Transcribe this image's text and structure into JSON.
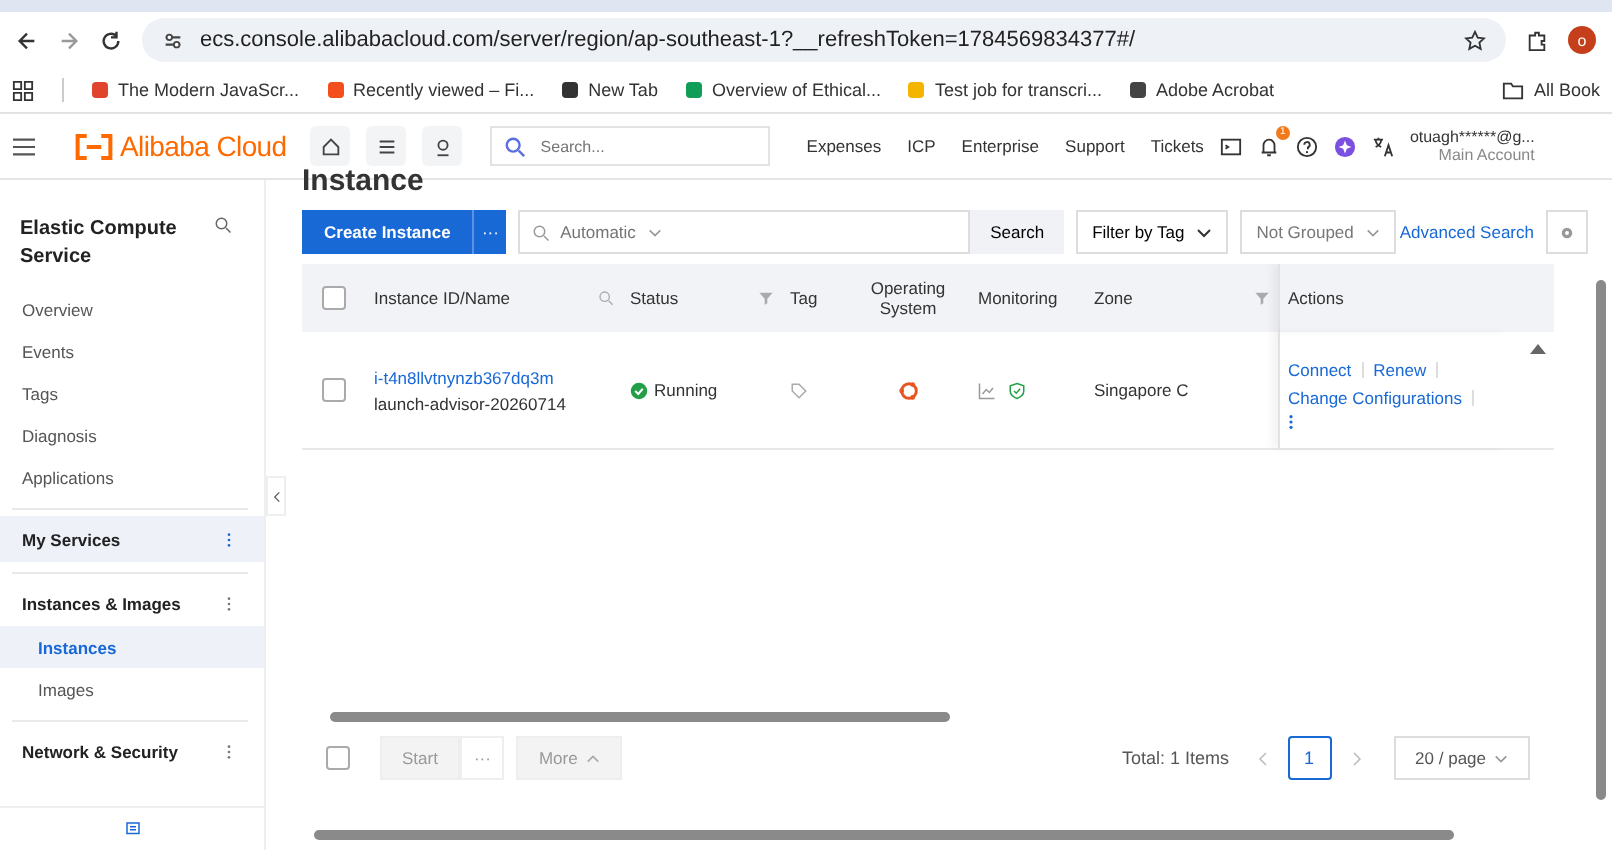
{
  "browser": {
    "url": "ecs.console.alibabacloud.com/server/region/ap-southeast-1?__refreshToken=1784569834377#/",
    "profile_initial": "o",
    "bookmarks": [
      {
        "label": "The Modern JavaScr...",
        "color": "#e0442c"
      },
      {
        "label": "Recently viewed – Fi...",
        "color": "#f24e1e"
      },
      {
        "label": "New Tab",
        "color": "#333333"
      },
      {
        "label": "Overview of Ethical...",
        "color": "#0f9d58"
      },
      {
        "label": "Test job for transcri...",
        "color": "#f4b400"
      },
      {
        "label": "Adobe Acrobat",
        "color": "#444444"
      }
    ],
    "all_bookmarks": "All Book"
  },
  "header": {
    "logo": "Alibaba Cloud",
    "search_placeholder": "Search...",
    "nav": [
      "Expenses",
      "ICP",
      "Enterprise",
      "Support",
      "Tickets"
    ],
    "notification_count": "1",
    "account": "otuagh******@g...",
    "account_role": "Main Account"
  },
  "sidebar": {
    "title": "Elastic Compute Service",
    "items": [
      {
        "kind": "link",
        "label": "Overview",
        "selected": false
      },
      {
        "kind": "link",
        "label": "Events",
        "selected": false
      },
      {
        "kind": "link",
        "label": "Tags",
        "selected": false
      },
      {
        "kind": "link",
        "label": "Diagnosis",
        "selected": false
      },
      {
        "kind": "link",
        "label": "Applications",
        "selected": false
      },
      {
        "kind": "section",
        "label": "My Services",
        "selected": true
      },
      {
        "kind": "section",
        "label": "Instances & Images",
        "selected": false
      },
      {
        "kind": "sublink",
        "label": "Instances",
        "selected": true
      },
      {
        "kind": "sublink",
        "label": "Images",
        "selected": false
      },
      {
        "kind": "section",
        "label": "Network & Security",
        "selected": false
      }
    ]
  },
  "page_title": "Instance",
  "toolbar": {
    "create": "Create Instance",
    "more": "···",
    "search_placeholder": "Automatic",
    "search": "Search",
    "filter_tag": "Filter by Tag",
    "grouping": "Not Grouped",
    "advanced": "Advanced Search"
  },
  "table": {
    "all_checked": false,
    "columns": [
      {
        "label": "Instance ID/Name",
        "kind": "searchable"
      },
      {
        "label": "Status",
        "kind": "filterable"
      },
      {
        "label": "Tag",
        "kind": "plain"
      },
      {
        "label": "Operating System",
        "kind": "plain"
      },
      {
        "label": "Monitoring",
        "kind": "plain"
      },
      {
        "label": "Zone",
        "kind": "filterable"
      },
      {
        "label": "Actions",
        "kind": "plain"
      }
    ],
    "rows": [
      {
        "checked": false,
        "id": "i-t4n8llvtnynzb367dq3m",
        "name": "launch-advisor-20260714",
        "status": "Running",
        "zone": "Singapore C",
        "actions": [
          "Connect",
          "Renew",
          "Change Configurations"
        ]
      }
    ]
  },
  "footer": {
    "checked": false,
    "start": "Start",
    "more_dots": "···",
    "more": "More",
    "total": "Total: 1 Items",
    "page": "1",
    "page_size": "20 / page"
  }
}
